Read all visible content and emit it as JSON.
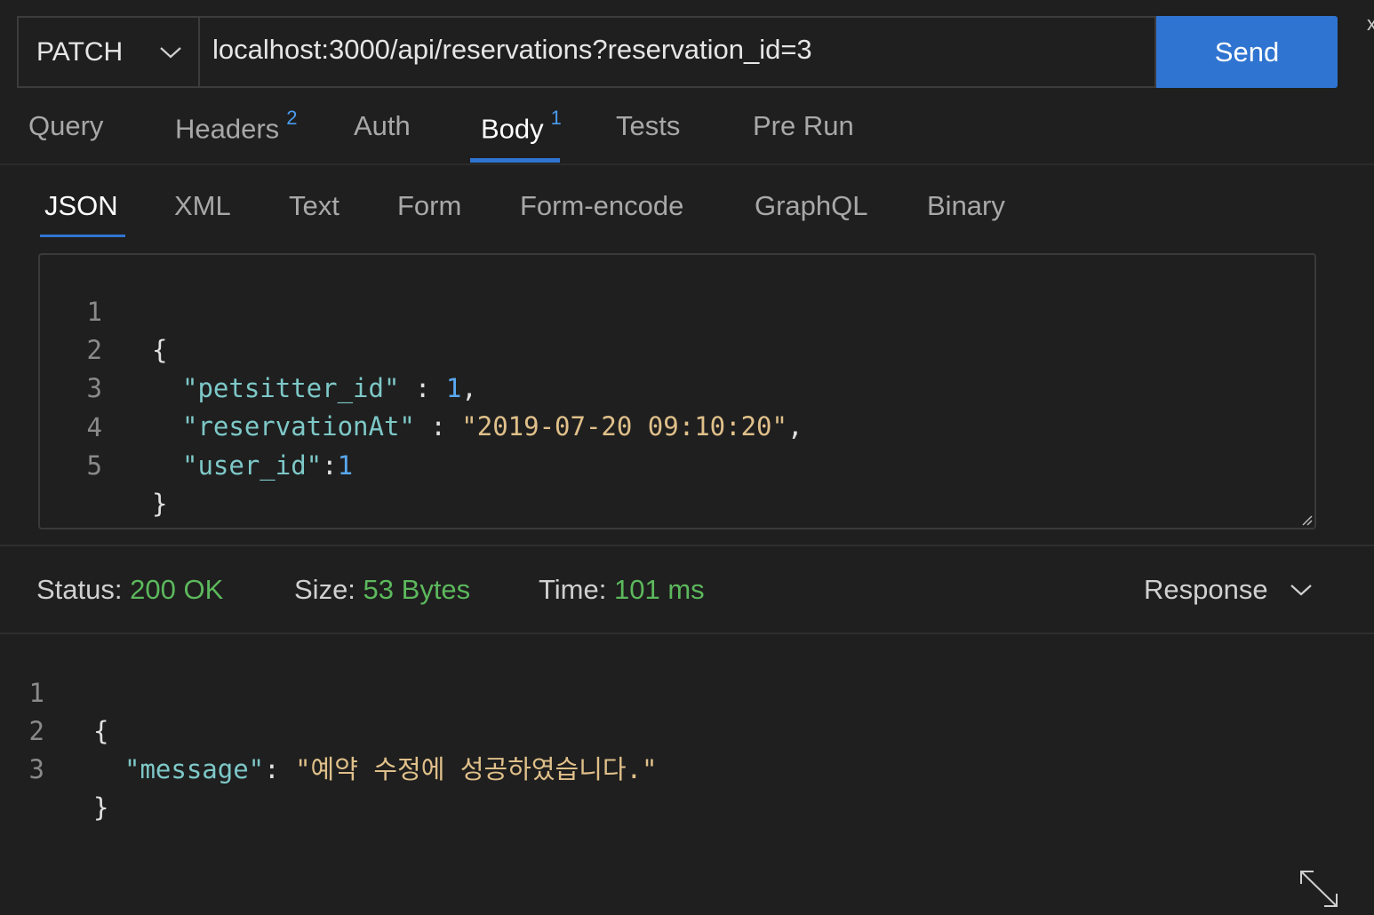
{
  "request": {
    "method": "PATCH",
    "url": "localhost:3000/api/reservations?reservation_id=3",
    "send_label": "Send"
  },
  "corner_glyph": "x",
  "main_tabs": [
    {
      "label": "Query",
      "badge": ""
    },
    {
      "label": "Headers",
      "badge": "2"
    },
    {
      "label": "Auth",
      "badge": ""
    },
    {
      "label": "Body",
      "badge": "1",
      "active": true
    },
    {
      "label": "Tests",
      "badge": ""
    },
    {
      "label": "Pre Run",
      "badge": ""
    }
  ],
  "body_tabs": [
    {
      "label": "JSON",
      "active": true
    },
    {
      "label": "XML"
    },
    {
      "label": "Text"
    },
    {
      "label": "Form"
    },
    {
      "label": "Form-encode"
    },
    {
      "label": "GraphQL"
    },
    {
      "label": "Binary"
    }
  ],
  "request_body": {
    "line_numbers": [
      "1",
      "2",
      "3",
      "4",
      "5"
    ],
    "open_brace": "{",
    "close_brace": "}",
    "fields": [
      {
        "key": "\"petsitter_id\"",
        "sep": " : ",
        "value": "1",
        "trail": ","
      },
      {
        "key": "\"reservationAt\"",
        "sep": " : ",
        "value": "\"2019-07-20 09:10:20\"",
        "trail": ","
      },
      {
        "key": "\"user_id\"",
        "sep": ":",
        "value": "1",
        "trail": ""
      }
    ]
  },
  "status": {
    "status_label": "Status:",
    "status_value": "200 OK",
    "size_label": "Size:",
    "size_value": "53 Bytes",
    "time_label": "Time:",
    "time_value": "101 ms",
    "view_label": "Response"
  },
  "response_body": {
    "line_numbers": [
      "1",
      "2",
      "3"
    ],
    "open_brace": "{",
    "close_brace": "}",
    "key": "\"message\"",
    "sep": ": ",
    "value": "\"예약 수정에 성공하였습니다.\""
  },
  "icons": {
    "method_dropdown": "chevron-down-icon",
    "response_dropdown": "chevron-down-icon",
    "resize": "resize-grip-icon",
    "expand": "expand-diagonal-icon"
  },
  "colors": {
    "send_button": "#2f74d0",
    "active_underline": "#2f74d0",
    "badge": "#4a9cf0",
    "status_ok": "#5cb85c",
    "json_key": "#7ec8c8",
    "json_number": "#5aa8f0",
    "json_string": "#e0c08a"
  }
}
